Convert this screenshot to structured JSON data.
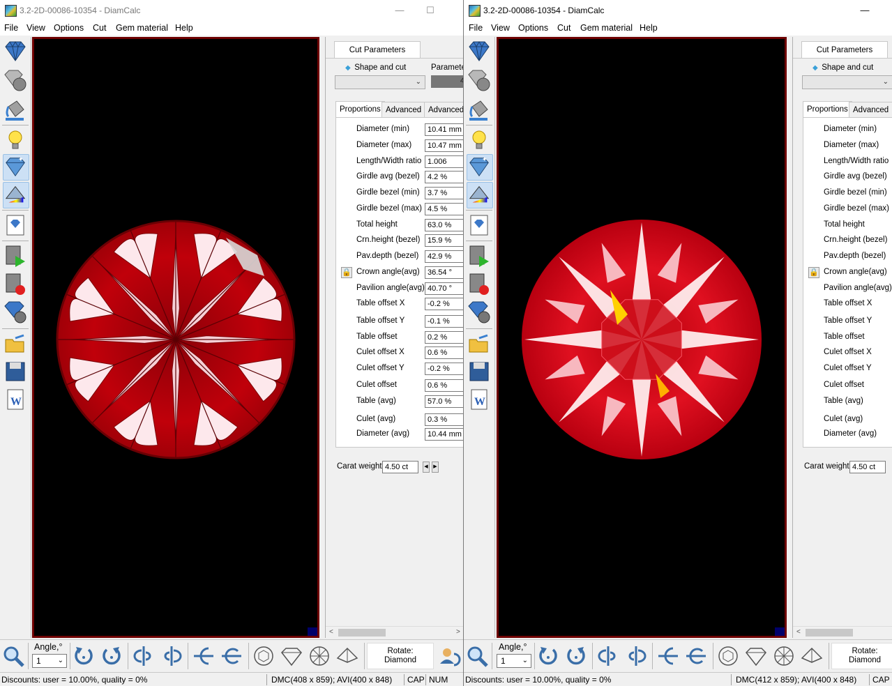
{
  "colors": {
    "viewport_border": "#6e0000",
    "gem_red": "#c8000a",
    "accent": "#00006a"
  },
  "window_left": {
    "title": "3.2-2D-00086-10354 - DiamCalc",
    "controls": {
      "minimize": "—",
      "maximize": "☐"
    },
    "menu": [
      "File",
      "View",
      "Options",
      "Cut",
      "Gem material",
      "Help"
    ],
    "panel": {
      "tab": "Cut Parameters",
      "shape_label": "Shape and cut",
      "parameters_label": "Parameter",
      "parameters_value": "4",
      "subtabs": [
        "Proportions",
        "Advanced",
        "Advanced"
      ],
      "rows": [
        {
          "label": "Diameter (min)",
          "value": "10.41 mm"
        },
        {
          "label": "Diameter (max)",
          "value": "10.47 mm"
        },
        {
          "label": "Length/Width ratio",
          "value": "1.006"
        },
        {
          "label": "Girdle avg (bezel)",
          "value": "4.2 %"
        },
        {
          "label": "Girdle bezel (min)",
          "value": "3.7 %"
        },
        {
          "label": "Girdle bezel (max)",
          "value": "4.5 %"
        },
        {
          "label": "Total height",
          "value": "63.0 %"
        },
        {
          "label": "Crn.height (bezel)",
          "value": "15.9 %"
        },
        {
          "label": "Pav.depth (bezel)",
          "value": "42.9 %"
        },
        {
          "label": "Crown angle(avg)",
          "value": "36.54 °"
        },
        {
          "label": "Pavilion angle(avg)",
          "value": "40.70 °"
        },
        {
          "label": "Table offset X",
          "value": "-0.2 %"
        },
        {
          "label": "Table offset Y",
          "value": "-0.1 %"
        },
        {
          "label": "Table offset",
          "value": "0.2 %"
        },
        {
          "label": "Culet offset X",
          "value": "0.6 %"
        },
        {
          "label": "Culet offset Y",
          "value": "-0.2 %"
        },
        {
          "label": "Culet offset",
          "value": "0.6 %"
        },
        {
          "label": "Table (avg)",
          "value": "57.0 %"
        },
        {
          "label": "Culet (avg)",
          "value": "0.3 %"
        },
        {
          "label": "Diameter (avg)",
          "value": "10.44 mm"
        }
      ],
      "carat_label": "Carat weight",
      "carat_value": "4.50 ct"
    },
    "bottom": {
      "angle_label": "Angle,°",
      "angle_value": "1",
      "rotate_line1": "Rotate:",
      "rotate_line2": "Diamond"
    },
    "status": {
      "discounts": "Discounts: user = 10.00%, quality = 0%",
      "dmc": "DMC(408 x 859); AVI(400 x 848)",
      "cap": "CAP",
      "num": "NUM"
    }
  },
  "window_right": {
    "title": "3.2-2D-00086-10354 - DiamCalc",
    "controls": {
      "minimize": "—"
    },
    "menu": [
      "File",
      "View",
      "Options",
      "Cut",
      "Gem material",
      "Help"
    ],
    "panel": {
      "tab": "Cut Parameters",
      "shape_label": "Shape and cut",
      "subtabs": [
        "Proportions",
        "Advanced"
      ],
      "rows": [
        {
          "label": "Diameter (min)"
        },
        {
          "label": "Diameter (max)"
        },
        {
          "label": "Length/Width ratio"
        },
        {
          "label": "Girdle avg (bezel)"
        },
        {
          "label": "Girdle bezel (min)"
        },
        {
          "label": "Girdle bezel (max)"
        },
        {
          "label": "Total height"
        },
        {
          "label": "Crn.height (bezel)"
        },
        {
          "label": "Pav.depth (bezel)"
        },
        {
          "label": "Crown angle(avg)"
        },
        {
          "label": "Pavilion angle(avg)"
        },
        {
          "label": "Table offset X"
        },
        {
          "label": "Table offset Y"
        },
        {
          "label": "Table offset"
        },
        {
          "label": "Culet offset X"
        },
        {
          "label": "Culet offset Y"
        },
        {
          "label": "Culet offset"
        },
        {
          "label": "Table (avg)"
        },
        {
          "label": "Culet (avg)"
        },
        {
          "label": "Diameter (avg)"
        }
      ],
      "carat_label": "Carat weight",
      "carat_value": "4.50 ct"
    },
    "bottom": {
      "angle_label": "Angle,°",
      "angle_value": "1",
      "rotate_line1": "Rotate:",
      "rotate_line2": "Diamond"
    },
    "status": {
      "discounts": "Discounts: user = 10.00%, quality = 0%",
      "dmc": "DMC(412 x 859); AVI(400 x 848)",
      "cap": "CAP"
    }
  }
}
